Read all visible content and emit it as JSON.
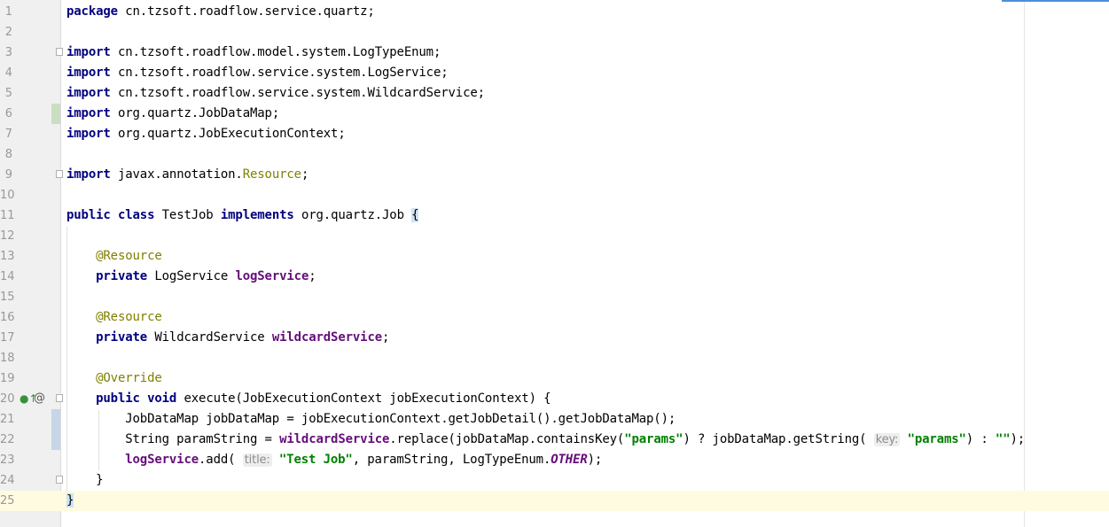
{
  "editor": {
    "language": "java",
    "colors": {
      "keyword": "#000080",
      "annotation": "#808000",
      "field": "#660e7a",
      "string": "#008000",
      "gutter_bg": "#f0f0f0",
      "current_line": "#fffbe0"
    },
    "icons": {
      "line_20_gutter": [
        "implements-method-icon",
        "override-annotation-icon"
      ]
    },
    "lines": [
      {
        "n": "1",
        "t": "package cn.tzsoft.roadflow.service.quartz;"
      },
      {
        "n": "2",
        "t": ""
      },
      {
        "n": "3",
        "t": "import cn.tzsoft.roadflow.model.system.LogTypeEnum;"
      },
      {
        "n": "4",
        "t": "import cn.tzsoft.roadflow.service.system.LogService;"
      },
      {
        "n": "5",
        "t": "import cn.tzsoft.roadflow.service.system.WildcardService;"
      },
      {
        "n": "6",
        "t": "import org.quartz.JobDataMap;"
      },
      {
        "n": "7",
        "t": "import org.quartz.JobExecutionContext;"
      },
      {
        "n": "8",
        "t": ""
      },
      {
        "n": "9",
        "t": "import javax.annotation.Resource;"
      },
      {
        "n": "10",
        "t": ""
      },
      {
        "n": "11",
        "t": "public class TestJob implements org.quartz.Job {"
      },
      {
        "n": "12",
        "t": ""
      },
      {
        "n": "13",
        "t": "    @Resource"
      },
      {
        "n": "14",
        "t": "    private LogService logService;"
      },
      {
        "n": "15",
        "t": ""
      },
      {
        "n": "16",
        "t": "    @Resource"
      },
      {
        "n": "17",
        "t": "    private WildcardService wildcardService;"
      },
      {
        "n": "18",
        "t": ""
      },
      {
        "n": "19",
        "t": "    @Override"
      },
      {
        "n": "20",
        "t": "    public void execute(JobExecutionContext jobExecutionContext) {"
      },
      {
        "n": "21",
        "t": "        JobDataMap jobDataMap = jobExecutionContext.getJobDetail().getJobDataMap();"
      },
      {
        "n": "22",
        "t": "        String paramString = wildcardService.replace(jobDataMap.containsKey(\"params\") ? jobDataMap.getString( key: \"params\") : \"\");"
      },
      {
        "n": "23",
        "t": "        logService.add( title: \"Test Job\", paramString, LogTypeEnum.OTHER);"
      },
      {
        "n": "24",
        "t": "    }"
      },
      {
        "n": "25",
        "t": "}"
      }
    ]
  }
}
